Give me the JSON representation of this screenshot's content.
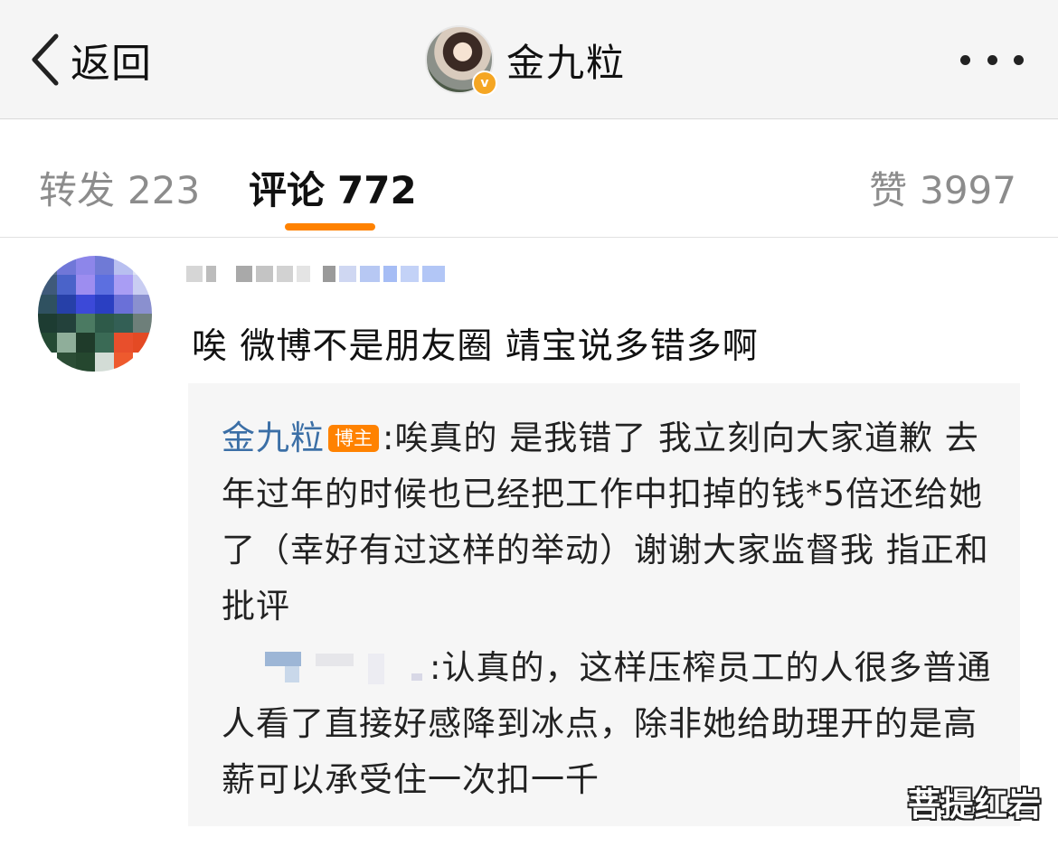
{
  "nav": {
    "back_label": "返回",
    "title": "金九粒",
    "verified_mark": "v",
    "icons": [
      "chevron-left-icon",
      "more-icon"
    ]
  },
  "tabs": {
    "repost_label": "转发",
    "repost_count": "223",
    "comments_label": "评论",
    "comments_count": "772",
    "likes_label": "赞",
    "likes_count": "3997",
    "active_tab": "评论",
    "indicator_color": "#ff8200"
  },
  "comment": {
    "text": "唉 微博不是朋友圈 靖宝说多错多啊",
    "reply": {
      "author": "金九粒",
      "badge": "博主",
      "text": "唉真的 是我错了 我立刻向大家道歉 去年过年的时候也已经把工作中扣掉的钱*5倍还给她了（幸好有过这样的举动）谢谢大家监督我 指正和批评"
    },
    "sub_reply": {
      "text": "认真的，这样压榨员工的人很多普通人看了直接好感降到冰点，除非她给助理开的是高薪可以承受住一次扣一千"
    }
  },
  "colors": {
    "author_link": "#3b6fa6",
    "badge": "#ff8200",
    "reply_background": "#f6f6f6",
    "navbar_background": "#f5f5f5"
  },
  "watermark": "菩提红岩"
}
